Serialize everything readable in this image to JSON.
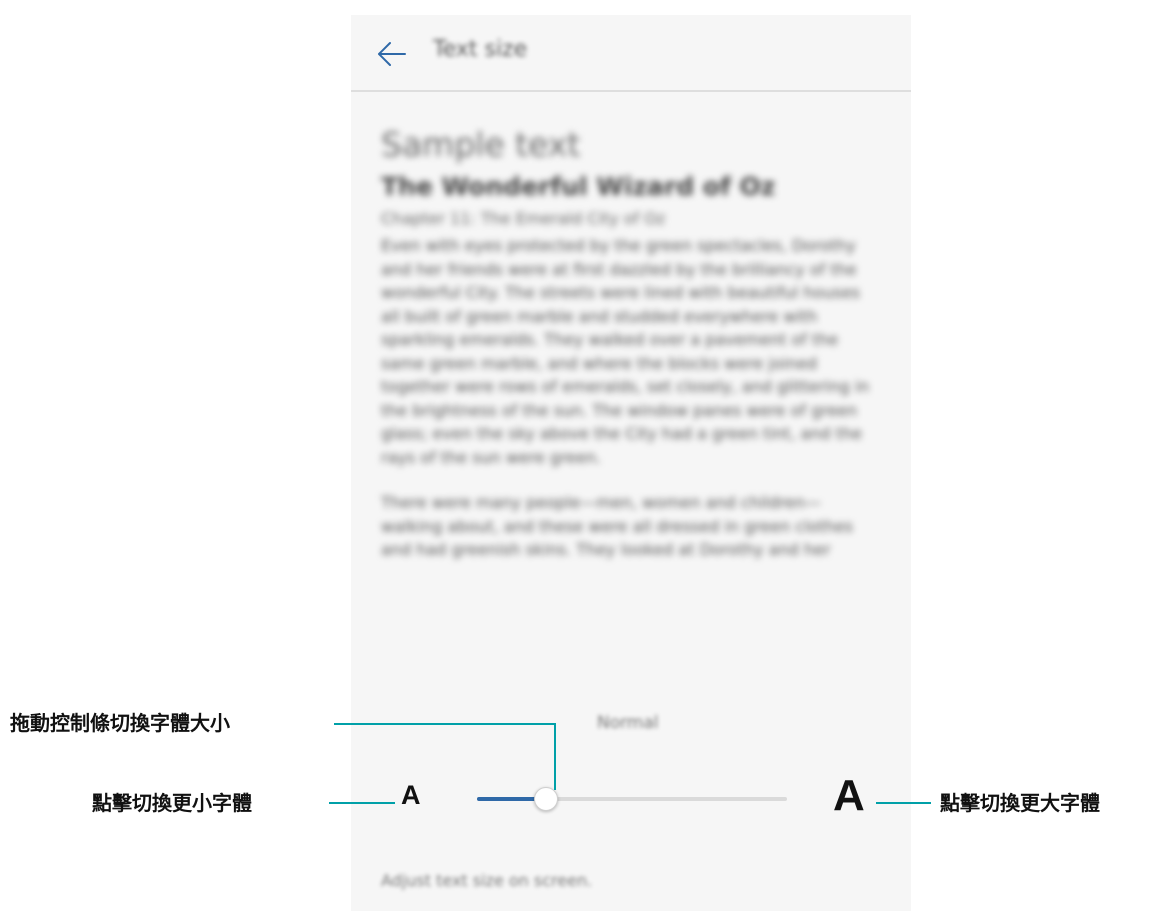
{
  "header": {
    "title": "Text size"
  },
  "preview": {
    "heading": "Sample text",
    "book_title": "The Wonderful Wizard of Oz",
    "chapter": "Chapter 11: The Emerald City of Oz",
    "paragraph1": "Even with eyes protected by the green spectacles, Dorothy and her friends were at first dazzled by the brilliancy of the wonderful City. The streets were lined with beautiful houses all built of green marble and studded everywhere with sparkling emeralds. They walked over a pavement of the same green marble, and where the blocks were joined together were rows of emeralds, set closely, and glittering in the brightness of the sun. The window panes were of green glass; even the sky above the City had a green tint, and the rays of the sun were green.",
    "paragraph2": "There were many people—men, women and children—walking about, and these were all dressed in green clothes and had greenish skins. They looked at Dorothy and her strangely assorted company with wondering eyes."
  },
  "slider": {
    "current_label": "Normal",
    "value": 0.22
  },
  "footer": {
    "help": "Adjust text size on screen."
  },
  "controls": {
    "small_a": "A",
    "large_a": "A"
  },
  "callouts": {
    "drag": "拖動控制條切換字體大小",
    "smaller": "點擊切換更小字體",
    "larger": "點擊切換更大字體"
  },
  "colors": {
    "accent": "#2f69a8",
    "leader": "#00a0a8"
  },
  "icons": {
    "back": "arrow-left-icon"
  }
}
